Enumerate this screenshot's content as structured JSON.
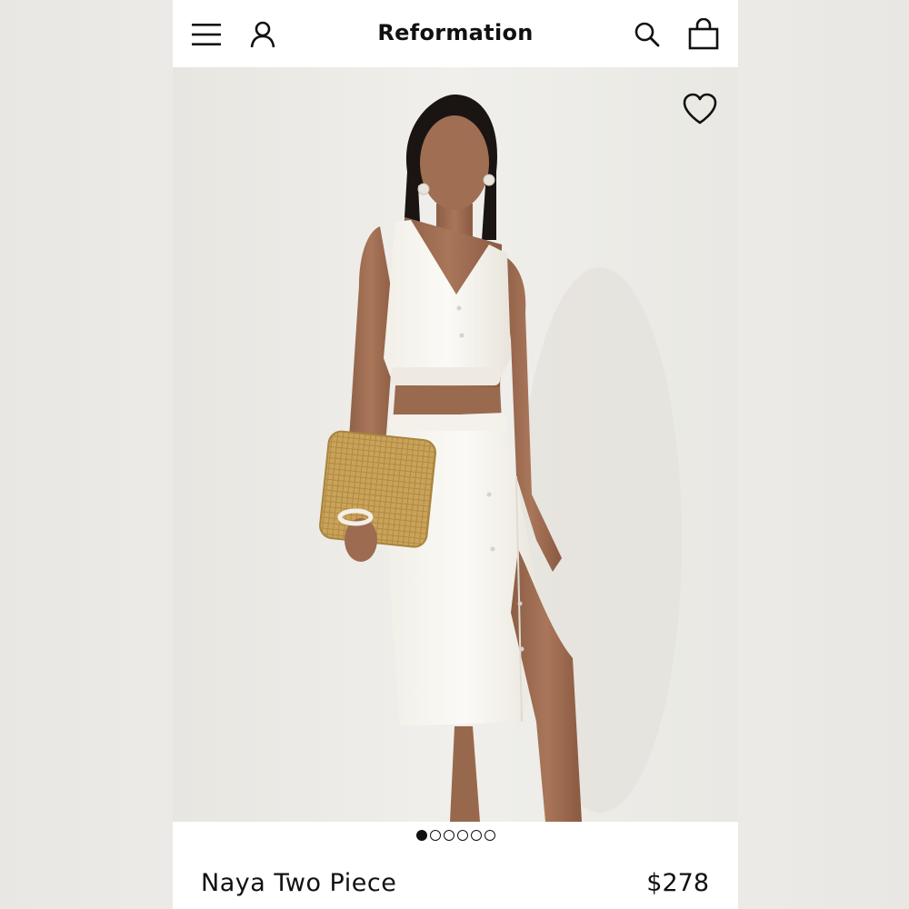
{
  "header": {
    "brand": "Reformation",
    "icons": [
      "menu-icon",
      "account-icon",
      "search-icon",
      "shopping-bag-icon"
    ]
  },
  "product": {
    "name": "Naya Two Piece",
    "price": "$278",
    "image_count": 6,
    "current_image": 1
  },
  "colors": {
    "text": "#111111",
    "background": "#ffffff",
    "photo_backdrop": "#edece8"
  }
}
